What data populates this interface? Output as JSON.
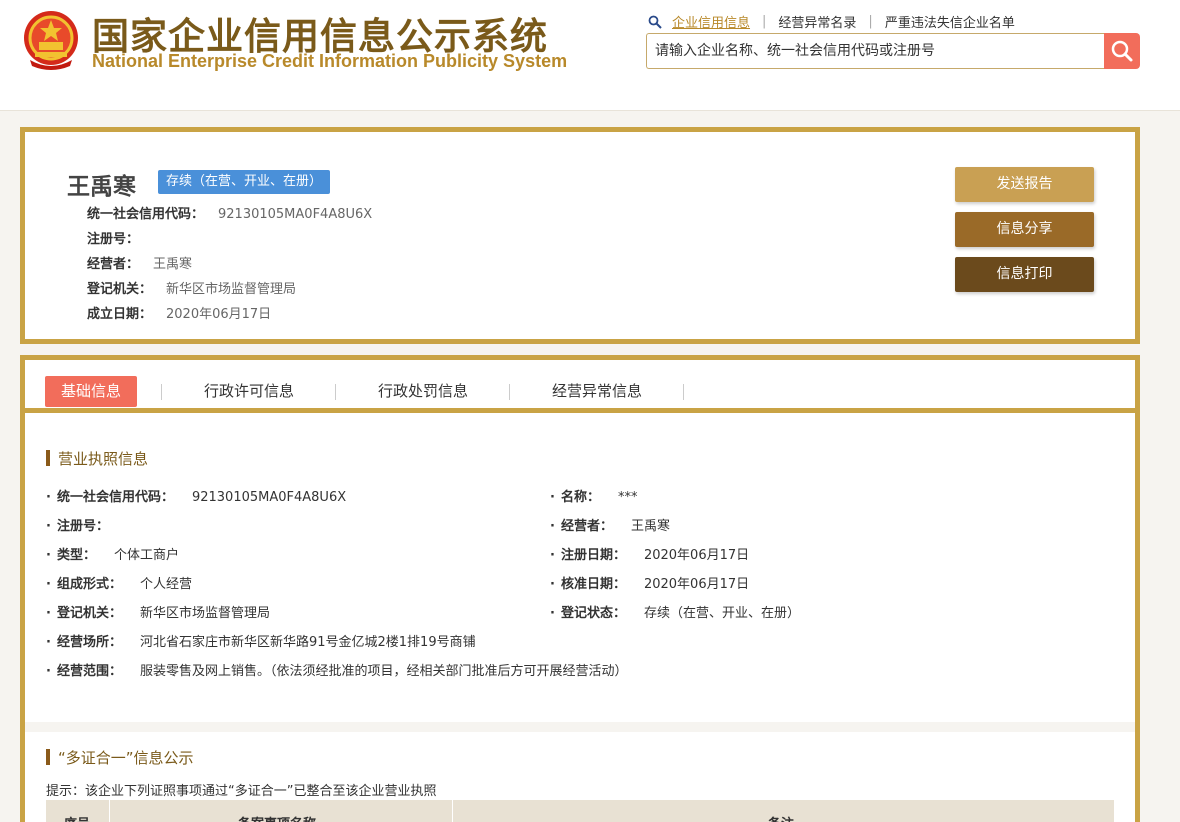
{
  "header": {
    "title_cn": "国家企业信用信息公示系统",
    "title_en": "National Enterprise Credit Information Publicity System",
    "links": [
      "企业信用信息",
      "经营异常名录",
      "严重违法失信企业名单"
    ],
    "search_placeholder": "请输入企业名称、统一社会信用代码或注册号"
  },
  "company": {
    "name": "王禹寒",
    "status": "存续（在营、开业、在册）",
    "fields": [
      {
        "label": "统一社会信用代码：",
        "value": "92130105MA0F4A8U6X"
      },
      {
        "label": "注册号：",
        "value": ""
      },
      {
        "label": "经营者：",
        "value": "王禹寒"
      },
      {
        "label": "登记机关：",
        "value": "新华区市场监督管理局"
      },
      {
        "label": "成立日期：",
        "value": "2020年06月17日"
      }
    ],
    "buttons": [
      "发送报告",
      "信息分享",
      "信息打印"
    ]
  },
  "tabs": [
    "基础信息",
    "行政许可信息",
    "行政处罚信息",
    "经营异常信息"
  ],
  "license": {
    "title": "营业执照信息",
    "left": [
      {
        "label": "统一社会信用代码：",
        "value": "92130105MA0F4A8U6X"
      },
      {
        "label": "注册号：",
        "value": ""
      },
      {
        "label": "类型：",
        "value": "个体工商户"
      },
      {
        "label": "组成形式：",
        "value": "个人经营"
      },
      {
        "label": "登记机关：",
        "value": "新华区市场监督管理局"
      },
      {
        "label": "经营场所：",
        "value": "河北省石家庄市新华区新华路91号金亿城2楼1排19号商铺"
      },
      {
        "label": "经营范围：",
        "value": "服装零售及网上销售。（依法须经批准的项目，经相关部门批准后方可开展经营活动）"
      }
    ],
    "right": [
      {
        "label": "名称：",
        "value": "***"
      },
      {
        "label": "经营者：",
        "value": "王禹寒"
      },
      {
        "label": "注册日期：",
        "value": "2020年06月17日"
      },
      {
        "label": "核准日期：",
        "value": "2020年06月17日"
      },
      {
        "label": "登记状态：",
        "value": "存续（在营、开业、在册）"
      }
    ]
  },
  "multi_cert": {
    "title": "“多证合一”信息公示",
    "hint": "提示：该企业下列证照事项通过“多证合一”已整合至该企业营业执照",
    "columns": [
      "序号",
      "备案事项名称",
      "备注"
    ]
  },
  "colors": {
    "gold_border": "#c9a345",
    "accent_red": "#f26d5b",
    "badge_blue": "#4a90d9",
    "btn1": "#c9a053",
    "btn2": "#9a6a28",
    "btn3": "#6b4a1c"
  }
}
